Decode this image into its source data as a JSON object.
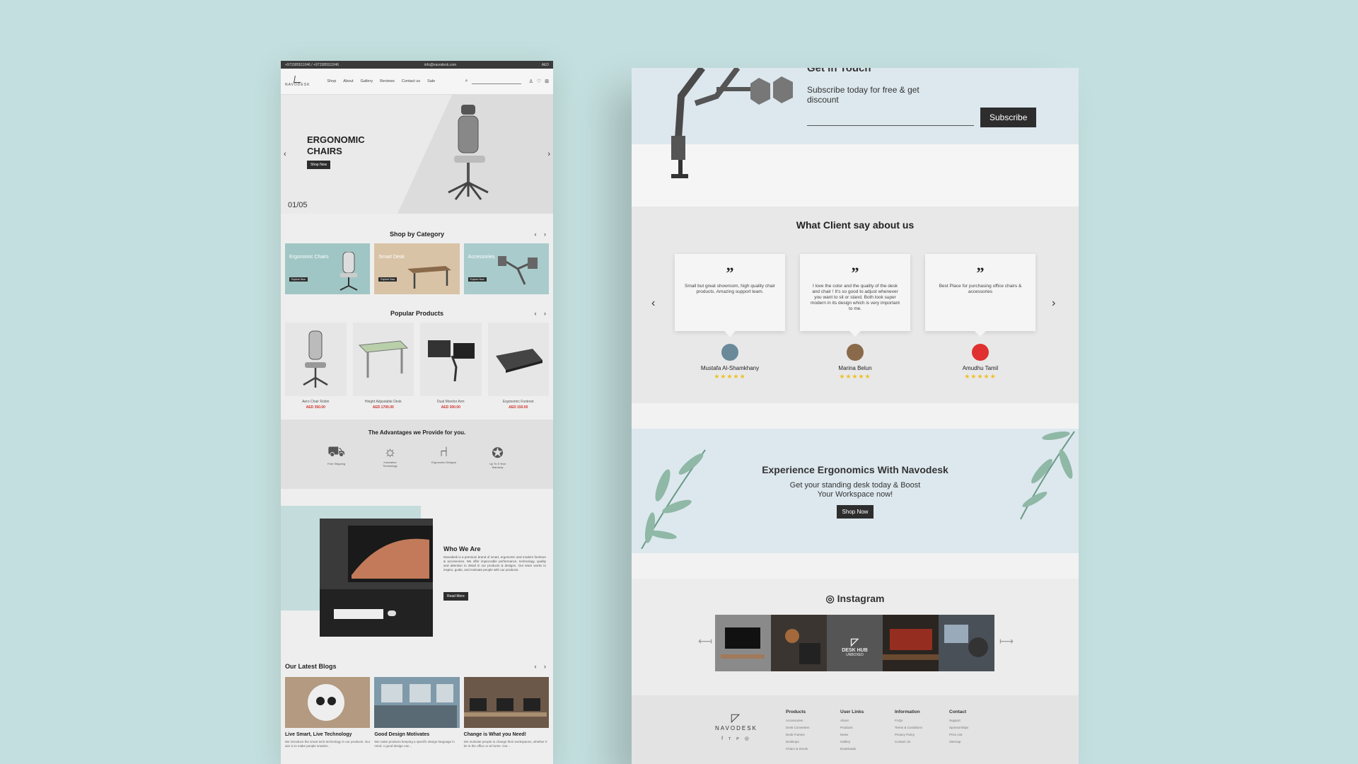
{
  "left_page": {
    "topbar": {
      "phone": "+971585511046 / +971585511046",
      "email": "info@navodesk.com",
      "lang": "AED"
    },
    "nav": {
      "logo": "NAVODESK",
      "menu": [
        "Shop",
        "About",
        "Gallery",
        "Reviews",
        "Contact us",
        "Sale"
      ]
    },
    "hero": {
      "title": "ERGONOMIC CHAIRS",
      "button": "Shop Now",
      "counter": "01/05"
    },
    "categories": {
      "title": "Shop by Category",
      "items": [
        {
          "label": "Ergonomic Chairs",
          "button": "Explore Now"
        },
        {
          "label": "Smart Desk",
          "button": "Explore Now"
        },
        {
          "label": "Accessories",
          "button": "Explore Now"
        }
      ]
    },
    "popular": {
      "title": "Popular Products",
      "items": [
        {
          "name": "Aero Chair Robin",
          "price": "AED 350.00"
        },
        {
          "name": "Height Adjustable Desk",
          "price": "AED 1700.00"
        },
        {
          "name": "Dual Monitor Arm",
          "price": "AED 300.00"
        },
        {
          "name": "Ergonomic Footrest",
          "price": "AED 150.00"
        }
      ]
    },
    "advantages": {
      "title": "The Advantages we Provide for you.",
      "items": [
        "Free Shipping",
        "Innovative Technology",
        "Ergonomic Designs",
        "Up To 5 Year Warranty"
      ]
    },
    "who": {
      "title": "Who We Are",
      "text": "Navodesk is a premium brand of smart, ergonomic and modern furniture & accessories. We offer impeccable performance, technology, quality and attention to detail in our products & designs. Our team works to inspire, guide, and motivate people with our products.",
      "button": "Read More"
    },
    "blogs": {
      "title": "Our Latest Blogs",
      "items": [
        {
          "title": "Live Smart, Live Technology",
          "desc": "We introduce the smart tech technology in our products. Our aim is to make people smarter..."
        },
        {
          "title": "Good Design Motivates",
          "desc": "We make products keeping a specific design language in mind. A good design can..."
        },
        {
          "title": "Change is What you Need!",
          "desc": "We motivate people to change their workspaces, whether it be in the office or at home. Our..."
        }
      ]
    }
  },
  "right_page": {
    "subscribe": {
      "title": "Get in Touch",
      "subtitle": "Subscribe today for free & get discount",
      "button": "Subscribe"
    },
    "testimonials": {
      "title": "What Client say about us",
      "items": [
        {
          "text": "Small but great showroom, high quality chair products. Amazing support team.",
          "name": "Mustafa Al-Shamkhany",
          "stars": "★★★★★"
        },
        {
          "text": "I love the color and the quality of the desk and chair ! It's so good to adjust whenever you want to sit or stand. Both look super modern in its design which is very important to me.",
          "name": "Marina Belun",
          "stars": "★★★★★"
        },
        {
          "text": "Best Place for purchasing office chairs & accessories",
          "name": "Amudhu Tamil",
          "stars": "★★★★★"
        }
      ]
    },
    "experience": {
      "title": "Experience Ergonomics With Navodesk",
      "line1": "Get your standing desk today & Boost",
      "line2": "Your Workspace now!",
      "button": "Shop Now"
    },
    "instagram": {
      "title": "Instagram",
      "tile_text_1": "DESK HUB",
      "tile_text_2": "UNBOXED"
    },
    "footer": {
      "logo": "NAVODESK",
      "social": "f ᴛ ᴘ ◎",
      "columns": [
        {
          "title": "Products",
          "links": [
            "Accessories",
            "Desk Converters",
            "Desk Frames",
            "Desktops",
            "Chairs & Stools"
          ]
        },
        {
          "title": "User Links",
          "links": [
            "About",
            "Products",
            "News",
            "Gallery",
            "Downloads"
          ]
        },
        {
          "title": "Information",
          "links": [
            "FAQs",
            "Terms & Conditions",
            "Privacy Policy",
            "Contact Us"
          ]
        },
        {
          "title": "Contact",
          "links": [
            "Support",
            "Sponsorships",
            "Price List",
            "Sitemap"
          ]
        }
      ]
    }
  },
  "colors": {
    "background": "#c4dfdf",
    "accent_dark": "#2d2d2d",
    "price_red": "#d0342c",
    "star": "#f0c020"
  }
}
